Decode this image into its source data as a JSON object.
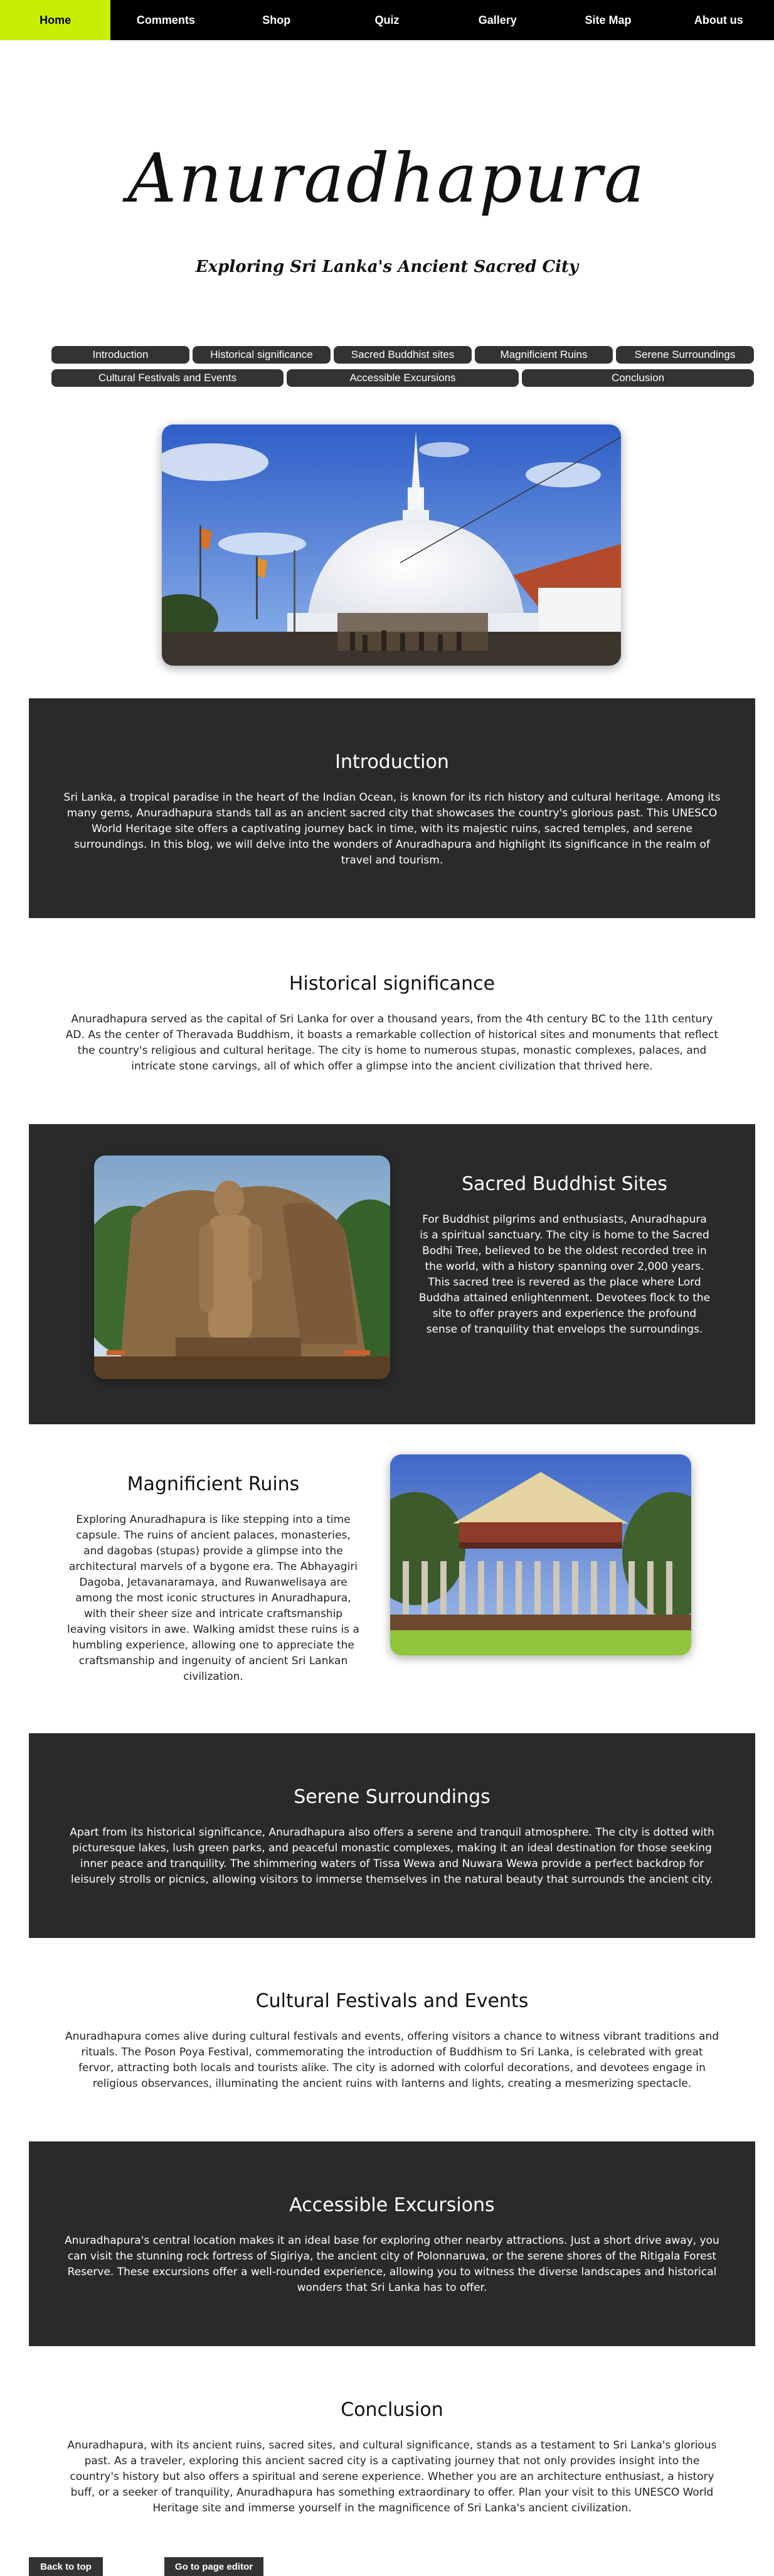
{
  "nav": {
    "items": [
      {
        "label": "Home",
        "active": true
      },
      {
        "label": "Comments"
      },
      {
        "label": "Shop"
      },
      {
        "label": "Quiz"
      },
      {
        "label": "Gallery"
      },
      {
        "label": "Site Map"
      },
      {
        "label": "About us"
      }
    ],
    "active_color": "#c7ef06"
  },
  "hero": {
    "title": "Anuradhapura",
    "subtitle": "Exploring Sri Lanka's Ancient Sacred City"
  },
  "section_links": [
    "Introduction",
    "Historical significance",
    "Sacred Buddhist sites",
    "Magnificient Ruins",
    "Serene Surroundings",
    "Cultural Festivals and Events",
    "Accessible Excursions",
    "Conclusion"
  ],
  "sections": {
    "introduction": {
      "title": "Introduction",
      "text": "Sri Lanka, a tropical paradise in the heart of the Indian Ocean, is known for its rich history and cultural heritage. Among its many gems, Anuradhapura stands tall as an ancient sacred city that showcases the country's glorious past. This UNESCO World Heritage site offers a captivating journey back in time, with its majestic ruins, sacred temples, and serene surroundings. In this blog, we will delve into the wonders of Anuradhapura and highlight its significance in the realm of travel and tourism."
    },
    "historical": {
      "title": "Historical significance",
      "text": "Anuradhapura served as the capital of Sri Lanka for over a thousand years, from the 4th century BC to the 11th century AD. As the center of Theravada Buddhism, it boasts a remarkable collection of historical sites and monuments that reflect the country's religious and cultural heritage. The city is home to numerous stupas, monastic complexes, palaces, and intricate stone carvings, all of which offer a glimpse into the ancient civilization that thrived here."
    },
    "sacred": {
      "title": "Sacred Buddhist Sites",
      "text": "For Buddhist pilgrims and enthusiasts, Anuradhapura is a spiritual sanctuary. The city is home to the Sacred Bodhi Tree, believed to be the oldest recorded tree in the world, with a history spanning over 2,000 years. This sacred tree is revered as the place where Lord Buddha attained enlightenment. Devotees flock to the site to offer prayers and experience the profound sense of tranquility that envelops the surroundings."
    },
    "ruins": {
      "title": "Magnificient Ruins",
      "text": "Exploring Anuradhapura is like stepping into a time capsule. The ruins of ancient palaces, monasteries, and dagobas (stupas) provide a glimpse into the architectural marvels of a bygone era. The Abhayagiri Dagoba, Jetavanaramaya, and Ruwanwelisaya are among the most iconic structures in Anuradhapura, with their sheer size and intricate craftsmanship leaving visitors in awe. Walking amidst these ruins is a humbling experience, allowing one to appreciate the craftsmanship and ingenuity of ancient Sri Lankan civilization."
    },
    "serene": {
      "title": "Serene Surroundings",
      "text": "Apart from its historical significance, Anuradhapura also offers a serene and tranquil atmosphere. The city is dotted with picturesque lakes, lush green parks, and peaceful monastic complexes, making it an ideal destination for those seeking inner peace and tranquility. The shimmering waters of Tissa Wewa and Nuwara Wewa provide a perfect backdrop for leisurely strolls or picnics, allowing visitors to immerse themselves in the natural beauty that surrounds the ancient city."
    },
    "festivals": {
      "title": "Cultural Festivals and Events",
      "text": "Anuradhapura comes alive during cultural festivals and events, offering visitors a chance to witness vibrant traditions and rituals. The Poson Poya Festival, commemorating the introduction of Buddhism to Sri Lanka, is celebrated with great fervor, attracting both locals and tourists alike. The city is adorned with colorful decorations, and devotees engage in religious observances, illuminating the ancient ruins with lanterns and lights, creating a mesmerizing spectacle."
    },
    "excursions": {
      "title": "Accessible Excursions",
      "text": "Anuradhapura's central location makes it an ideal base for exploring other nearby attractions. Just a short drive away, you can visit the stunning rock fortress of Sigiriya, the ancient city of Polonnaruwa, or the serene shores of the Ritigala Forest Reserve. These excursions offer a well-rounded experience, allowing you to witness the diverse landscapes and historical wonders that Sri Lanka has to offer."
    },
    "conclusion": {
      "title": "Conclusion",
      "text": "Anuradhapura, with its ancient ruins, sacred sites, and cultural significance, stands as a testament to Sri Lanka's glorious past. As a traveler, exploring this ancient sacred city is a captivating journey that not only provides insight into the country's history but also offers a spiritual and serene experience. Whether you are an architecture enthusiast, a history buff, or a seeker of tranquility, Anuradhapura has something extraordinary to offer. Plan your visit to this UNESCO World Heritage site and immerse yourself in the magnificence of Sri Lanka's ancient civilization."
    }
  },
  "footer": {
    "back_to_top": "Back to top",
    "page_editor": "Go to page editor"
  },
  "colors": {
    "nav_bg": "#000000",
    "panel_bg": "#2a2a2a",
    "pill_bg": "#333333"
  }
}
